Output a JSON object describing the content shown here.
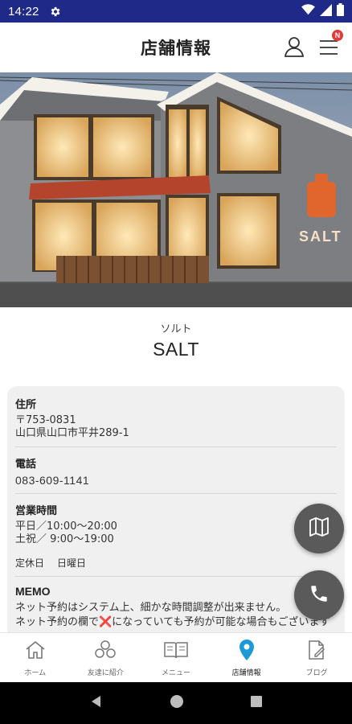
{
  "status_bar": {
    "time": "14:22"
  },
  "header": {
    "title": "店舗情報",
    "menu_badge": "N"
  },
  "shop": {
    "kana": "ソルト",
    "name": "SALT",
    "sign_text": "SALT"
  },
  "info": {
    "address_label": "住所",
    "postal_code": "〒753-0831",
    "address": "山口県山口市平井289-1",
    "phone_label": "電話",
    "phone": "083-609-1141",
    "hours_label": "営業時間",
    "hours_weekday": "平日／10:00〜20:00",
    "hours_weekend": "土祝／ 9:00〜19:00",
    "closed_label": "定休日",
    "closed_value": "日曜日",
    "memo_label": "MEMO",
    "memo_line1": "ネット予約はシステム上、細かな時間調整が出来ません。",
    "memo_line2": "ネット予約の欄で❌になっていても予約が可能な場合もございます"
  },
  "tabs": [
    {
      "label": "ホーム",
      "icon": "home-icon"
    },
    {
      "label": "友達に紹介",
      "icon": "friends-icon"
    },
    {
      "label": "メニュー",
      "icon": "book-icon"
    },
    {
      "label": "店舗情報",
      "icon": "location-pin-icon",
      "active": true
    },
    {
      "label": "ブログ",
      "icon": "blog-edit-icon"
    }
  ],
  "colors": {
    "status_bar": "#1f2a88",
    "active_tab": "#1a9ad6",
    "fab": "#5a5a5a",
    "badge": "#e53935",
    "card": "#f0f0f0"
  }
}
